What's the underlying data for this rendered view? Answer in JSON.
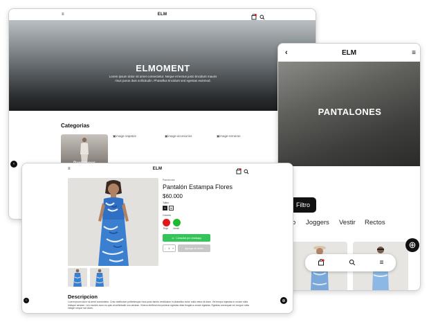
{
  "desktop": {
    "brand": "ELM",
    "menu_icon": "hamburger-icon",
    "hero_title": "ELMOMENT",
    "hero_text": "Lorem ipsum dolor sit amet consectetur. Neque et lectus justo tincidunt mauris risus purus duis sollicitudin. Phasellus tincidunt sed egestas euismod.",
    "categories_title": "Categorias",
    "category_card_label": "Pantalones",
    "category_images": [
      "image-zapatos",
      "image-accesorios",
      "image-remeras"
    ]
  },
  "mobile": {
    "brand": "ELM",
    "hero_title": "PANTALONES",
    "filter_label": "Filtro",
    "tabs": [
      "o",
      "Joggers",
      "Vestir",
      "Rectos"
    ],
    "fab_icon": "plus-icon"
  },
  "product": {
    "brand": "ELM",
    "breadcrumb": "Pantalones",
    "name": "Pantalón Estampa Flores",
    "price": "$60.000",
    "sizes_label": "Talles",
    "sizes": [
      "S",
      "M"
    ],
    "colors_label": "Colores",
    "colors": [
      {
        "name": "Rojo",
        "hex": "#e11818"
      },
      {
        "name": "Verde",
        "hex": "#1db92e"
      }
    ],
    "whatsapp_label": "Consultar por whatsapp",
    "qty_minus": "-",
    "qty_value": "1",
    "qty_plus": "+",
    "add_to_cart_label": "Agregar al carrito",
    "description_title": "Descripcion",
    "description_text": "Lorem ipsum dolor sit amet consectetur. Cras vestibulum pellentesque risus justo fames vestibulum in phasellus tortor nulla netus sit diam. Vel tempor egestas in ornare nulla tristique aenean. Leo montes nunc eu quis at sollicitudin non aenean. Viverra eleifend nisi pulvinar egestas vitae feugiat a ornare egestas. Egestas consequat vel congue nulla integer neque non diam."
  },
  "colors": {
    "accent_dark": "#111111",
    "whatsapp_green": "#35c45a",
    "disabled_gray": "#c7c7c7"
  }
}
